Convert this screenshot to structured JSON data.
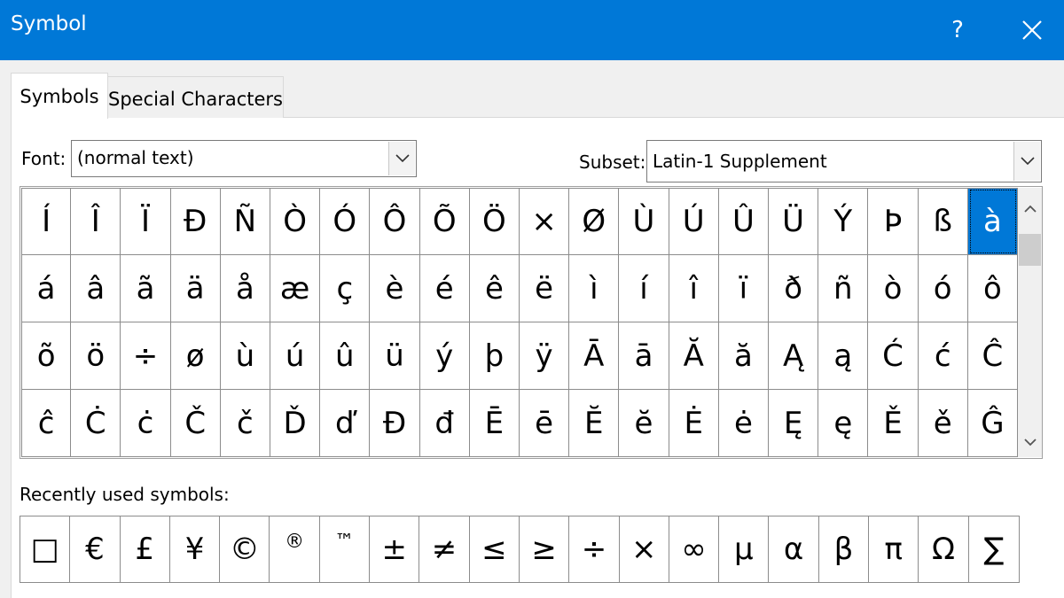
{
  "window": {
    "title": "Symbol",
    "help_label": "?",
    "close_icon": "close-icon"
  },
  "tabs": [
    {
      "label": "Symbols",
      "active": true
    },
    {
      "label": "Special Characters",
      "active": false
    }
  ],
  "font": {
    "label": "Font:",
    "value": "(normal text)"
  },
  "subset": {
    "label": "Subset:",
    "value": "Latin-1 Supplement"
  },
  "symbols": [
    "Í",
    "Î",
    "Ï",
    "Ð",
    "Ñ",
    "Ò",
    "Ó",
    "Ô",
    "Õ",
    "Ö",
    "×",
    "Ø",
    "Ù",
    "Ú",
    "Û",
    "Ü",
    "Ý",
    "Þ",
    "ß",
    "à",
    "á",
    "â",
    "ã",
    "ä",
    "å",
    "æ",
    "ç",
    "è",
    "é",
    "ê",
    "ë",
    "ì",
    "í",
    "î",
    "ï",
    "ð",
    "ñ",
    "ò",
    "ó",
    "ô",
    "õ",
    "ö",
    "÷",
    "ø",
    "ù",
    "ú",
    "û",
    "ü",
    "ý",
    "þ",
    "ÿ",
    "Ā",
    "ā",
    "Ă",
    "ă",
    "Ą",
    "ą",
    "Ć",
    "ć",
    "Ĉ",
    "ĉ",
    "Ċ",
    "ċ",
    "Č",
    "č",
    "Ď",
    "ď",
    "Đ",
    "đ",
    "Ē",
    "ē",
    "Ĕ",
    "ĕ",
    "Ė",
    "ė",
    "Ę",
    "ę",
    "Ě",
    "ě",
    "Ĝ"
  ],
  "selected_symbol_index": 19,
  "recent": {
    "label": "Recently used symbols:",
    "symbols": [
      "□",
      "€",
      "£",
      "¥",
      "©",
      "®",
      "™",
      "±",
      "≠",
      "≤",
      "≥",
      "÷",
      "×",
      "∞",
      "µ",
      "α",
      "β",
      "π",
      "Ω",
      "∑"
    ]
  },
  "colors": {
    "accent": "#0078d7",
    "background": "#f0f0f0"
  }
}
